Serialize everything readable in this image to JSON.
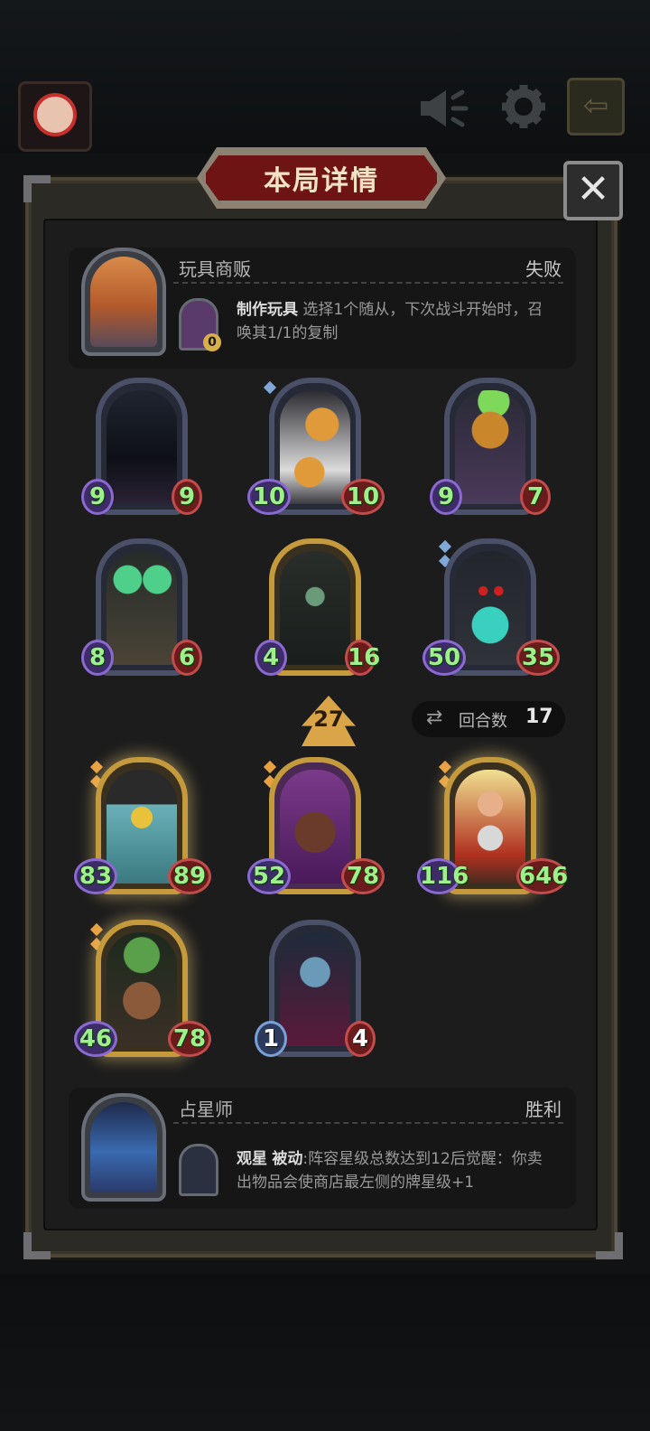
{
  "header": {
    "avatar": "avatar",
    "icons": [
      "megaphone-icon",
      "gear-icon",
      "exit-icon"
    ]
  },
  "dialog": {
    "title": "本局详情",
    "close_icon": "close-icon"
  },
  "opponent": {
    "name": "玩具商贩",
    "result": "失败",
    "skill_name": "制作玩具",
    "skill_desc": "选择1个随从，下次战斗开始时，召唤其1/1的复制",
    "skill_count": "0"
  },
  "opponent_units": [
    {
      "atk": "9",
      "hp": "9"
    },
    {
      "atk": "10",
      "hp": "10"
    },
    {
      "atk": "9",
      "hp": "7"
    },
    {
      "atk": "8",
      "hp": "6"
    },
    {
      "atk": "4",
      "hp": "16"
    },
    {
      "atk": "50",
      "hp": "35"
    }
  ],
  "level": "27",
  "round": {
    "label": "回合数",
    "value": "17"
  },
  "player_units": [
    {
      "atk": "83",
      "hp": "89"
    },
    {
      "atk": "52",
      "hp": "78"
    },
    {
      "atk": "116",
      "hp": "646"
    },
    {
      "atk": "46",
      "hp": "78"
    },
    {
      "atk": "1",
      "hp": "4"
    }
  ],
  "player": {
    "name": "占星师",
    "result": "胜利",
    "skill_name": "观星",
    "skill_tag": "被动",
    "skill_desc": ":阵容星级总数达到12后觉醒：你卖出物品会使商店最左侧的牌星级+1"
  },
  "colors": {
    "stat_green": "#9ef08a",
    "title_red": "#6e1414",
    "gold_frame": "#c59a3c"
  }
}
